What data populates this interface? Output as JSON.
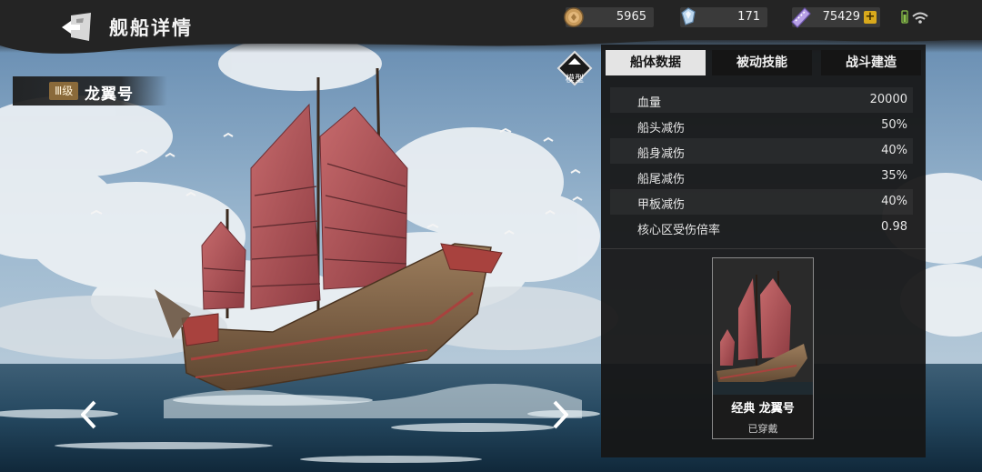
{
  "header": {
    "title": "舰船详情",
    "resources": {
      "gold": "5965",
      "gem": "171",
      "ticket": "75429"
    },
    "plus_label": "+"
  },
  "ship": {
    "grade": "Ⅲ级",
    "name": "龙翼号"
  },
  "model_button": {
    "label": "模型"
  },
  "tabs": [
    {
      "label": "船体数据",
      "active": true
    },
    {
      "label": "被动技能",
      "active": false
    },
    {
      "label": "战斗建造",
      "active": false
    }
  ],
  "stats": [
    {
      "label": "血量",
      "value": "20000"
    },
    {
      "label": "船头减伤",
      "value": "50%"
    },
    {
      "label": "船身减伤",
      "value": "40%"
    },
    {
      "label": "船尾减伤",
      "value": "35%"
    },
    {
      "label": "甲板减伤",
      "value": "40%"
    },
    {
      "label": "核心区受伤倍率",
      "value": "0.98"
    }
  ],
  "skin": {
    "name": "经典 龙翼号",
    "status": "已穿戴"
  },
  "colors": {
    "panel_bg": "#161616",
    "tab_active_bg": "#e4e4e4",
    "sail_red": "#b5555a",
    "hull_brown": "#8a6a4a",
    "gold_accent": "#d9a91c"
  }
}
